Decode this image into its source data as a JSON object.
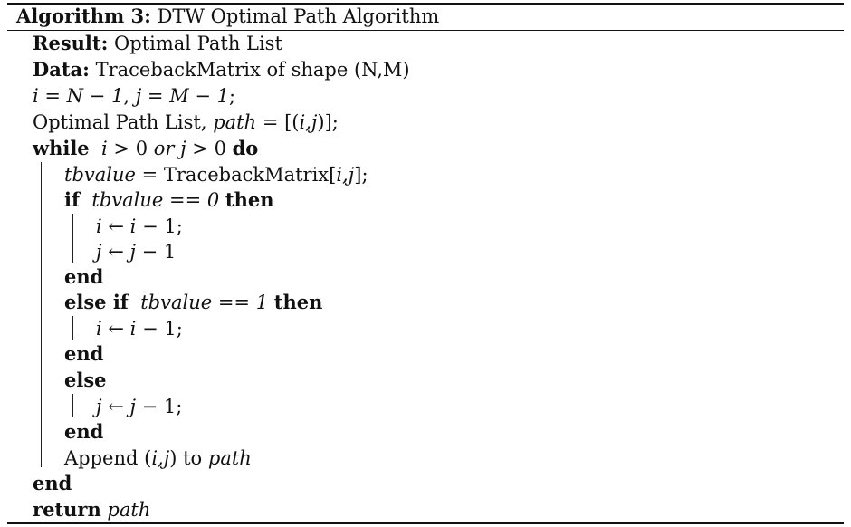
{
  "algorithm": {
    "label": "Algorithm 3:",
    "name": "DTW Optimal Path Algorithm"
  },
  "result": {
    "keyword": "Result:",
    "text": "Optimal Path List"
  },
  "data_line": {
    "keyword": "Data:",
    "text": "TracebackMatrix of shape (N,M)"
  },
  "init": {
    "i": "i",
    "eq1": " = ",
    "n_expr": "N − 1",
    "sep": ", ",
    "j": "j",
    "eq2": " = ",
    "m_expr": "M − 1",
    "end": ";"
  },
  "path_init": {
    "text": "Optimal Path List, ",
    "var": "path",
    "rhs": " = [(",
    "pair": "i,j",
    "close": ")];"
  },
  "while_line": {
    "keyword": "while",
    "c1": "i",
    "c1_rest": " > 0 ",
    "or": "or",
    "c2": "j",
    "c2_rest": " > 0 ",
    "do": "do"
  },
  "tb_assign": {
    "var": "tbvalue",
    "rhs": " = TracebackMatrix[",
    "idx": "i,j",
    "close": "];"
  },
  "if_line": {
    "keyword": "if",
    "var": "tbvalue",
    "op": " == ",
    "val": "0",
    "then": "then"
  },
  "if_body": {
    "line1_lhs": "i",
    "line1_arrow": " ← ",
    "line1_rhs": "i",
    "line1_rest": " − 1;",
    "line2_lhs": "j",
    "line2_arrow": " ← ",
    "line2_rhs": "j",
    "line2_rest": " − 1"
  },
  "end1": "end",
  "elseif_line": {
    "keyword": "else if",
    "var": "tbvalue",
    "op": " == ",
    "val": "1",
    "then": "then"
  },
  "elseif_body": {
    "lhs": "i",
    "arrow": " ← ",
    "rhs": "i",
    "rest": " − 1;"
  },
  "end2": "end",
  "else_keyword": "else",
  "else_body": {
    "lhs": "j",
    "arrow": " ← ",
    "rhs": "j",
    "rest": " − 1;"
  },
  "end3": "end",
  "append_line": {
    "text": "Append (",
    "pair": "i,j",
    "mid": ") to ",
    "var": "path"
  },
  "end4": "end",
  "return_line": {
    "keyword": "return",
    "var": "path"
  }
}
